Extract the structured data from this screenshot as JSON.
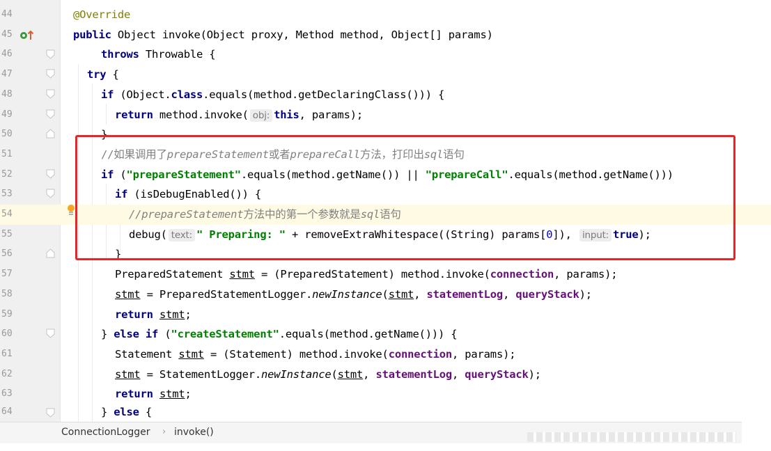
{
  "editor": {
    "lines": [
      {
        "num": "44"
      },
      {
        "num": "45"
      },
      {
        "num": "46"
      },
      {
        "num": "47"
      },
      {
        "num": "48"
      },
      {
        "num": "49"
      },
      {
        "num": "50"
      },
      {
        "num": "51"
      },
      {
        "num": "52"
      },
      {
        "num": "53"
      },
      {
        "num": "54"
      },
      {
        "num": "55"
      },
      {
        "num": "56"
      },
      {
        "num": "57"
      },
      {
        "num": "58"
      },
      {
        "num": "59"
      },
      {
        "num": "60"
      },
      {
        "num": "61"
      },
      {
        "num": "62"
      },
      {
        "num": "63"
      },
      {
        "num": "64"
      }
    ],
    "code": {
      "l44": {
        "annotation": "@Override"
      },
      "l45": {
        "kw": "public",
        "rest": " Object invoke(Object proxy, Method method, Object[] params)"
      },
      "l46": {
        "kw": "throws",
        "rest": " Throwable {"
      },
      "l47": {
        "kw": "try",
        "rest": " {"
      },
      "l48": {
        "kw1": "if",
        "a": " (Object.",
        "kw2": "class",
        "b": ".equals(method.getDeclaringClass())) {"
      },
      "l49": {
        "kw": "return",
        "a": " method.invoke(",
        "hint": "obj:",
        "kw2": "this",
        "b": ", params);"
      },
      "l50": {
        "text": "}"
      },
      "l51": {
        "c1": "//如果调用了",
        "c2": "prepareStatement",
        "c3": "或者",
        "c4": "prepareCall",
        "c5": "方法，打印出",
        "c6": "sql",
        "c7": "语句"
      },
      "l52": {
        "kw": "if",
        "a": " (",
        "s1": "\"prepareStatement\"",
        "b": ".equals(method.getName()) || ",
        "s2": "\"prepareCall\"",
        "c": ".equals(method.getName()))"
      },
      "l53": {
        "kw": "if",
        "rest": " (isDebugEnabled()) {"
      },
      "l54": {
        "c1": "//",
        "c2": "prepareStatement",
        "c3": "方法中的第一个参数就是",
        "c4": "sql",
        "c5": "语句"
      },
      "l55": {
        "a": "debug(",
        "hint1": "text:",
        "s": "\" Preparing: \"",
        "b": " + removeExtraWhitespace((String) params[",
        "n": "0",
        "c": "]), ",
        "hint2": "input:",
        "kw": "true",
        "d": ");"
      },
      "l56": {
        "text": "}"
      },
      "l57": {
        "a": "PreparedStatement ",
        "v": "stmt",
        "b": " = (PreparedStatement) method.invoke(",
        "f": "connection",
        "c": ", params);"
      },
      "l58": {
        "v": "stmt",
        "a": " = PreparedStatementLogger.",
        "m": "newInstance",
        "b": "(",
        "v2": "stmt",
        "c": ", ",
        "f1": "statementLog",
        "d": ", ",
        "f2": "queryStack",
        "e": ");"
      },
      "l59": {
        "kw": "return",
        "a": " ",
        "v": "stmt",
        "b": ";"
      },
      "l60": {
        "a": "} ",
        "kw1": "else if",
        "b": " (",
        "s": "\"createStatement\"",
        "c": ".equals(method.getName())) {"
      },
      "l61": {
        "a": "Statement ",
        "v": "stmt",
        "b": " = (Statement) method.invoke(",
        "f": "connection",
        "c": ", params);"
      },
      "l62": {
        "v": "stmt",
        "a": " = StatementLogger.",
        "m": "newInstance",
        "b": "(",
        "v2": "stmt",
        "c": ", ",
        "f1": "statementLog",
        "d": ", ",
        "f2": "queryStack",
        "e": ");"
      },
      "l63": {
        "kw": "return",
        "a": " ",
        "v": "stmt",
        "b": ";"
      },
      "l64": {
        "a": "} ",
        "kw": "else",
        "b": " {"
      }
    }
  },
  "breadcrumb": {
    "class_name": "ConnectionLogger",
    "separator": "›",
    "method_name": "invoke()"
  },
  "colors": {
    "highlight_box": "#e8262a",
    "current_line": "#fffae3",
    "keyword": "#000080",
    "string": "#008000",
    "comment": "#808080",
    "field": "#660e7a",
    "annotation": "#808000"
  },
  "icons": {
    "override": "override-gutter-icon",
    "bulb": "intention-bulb-icon",
    "fold": "fold-marker-icon"
  }
}
